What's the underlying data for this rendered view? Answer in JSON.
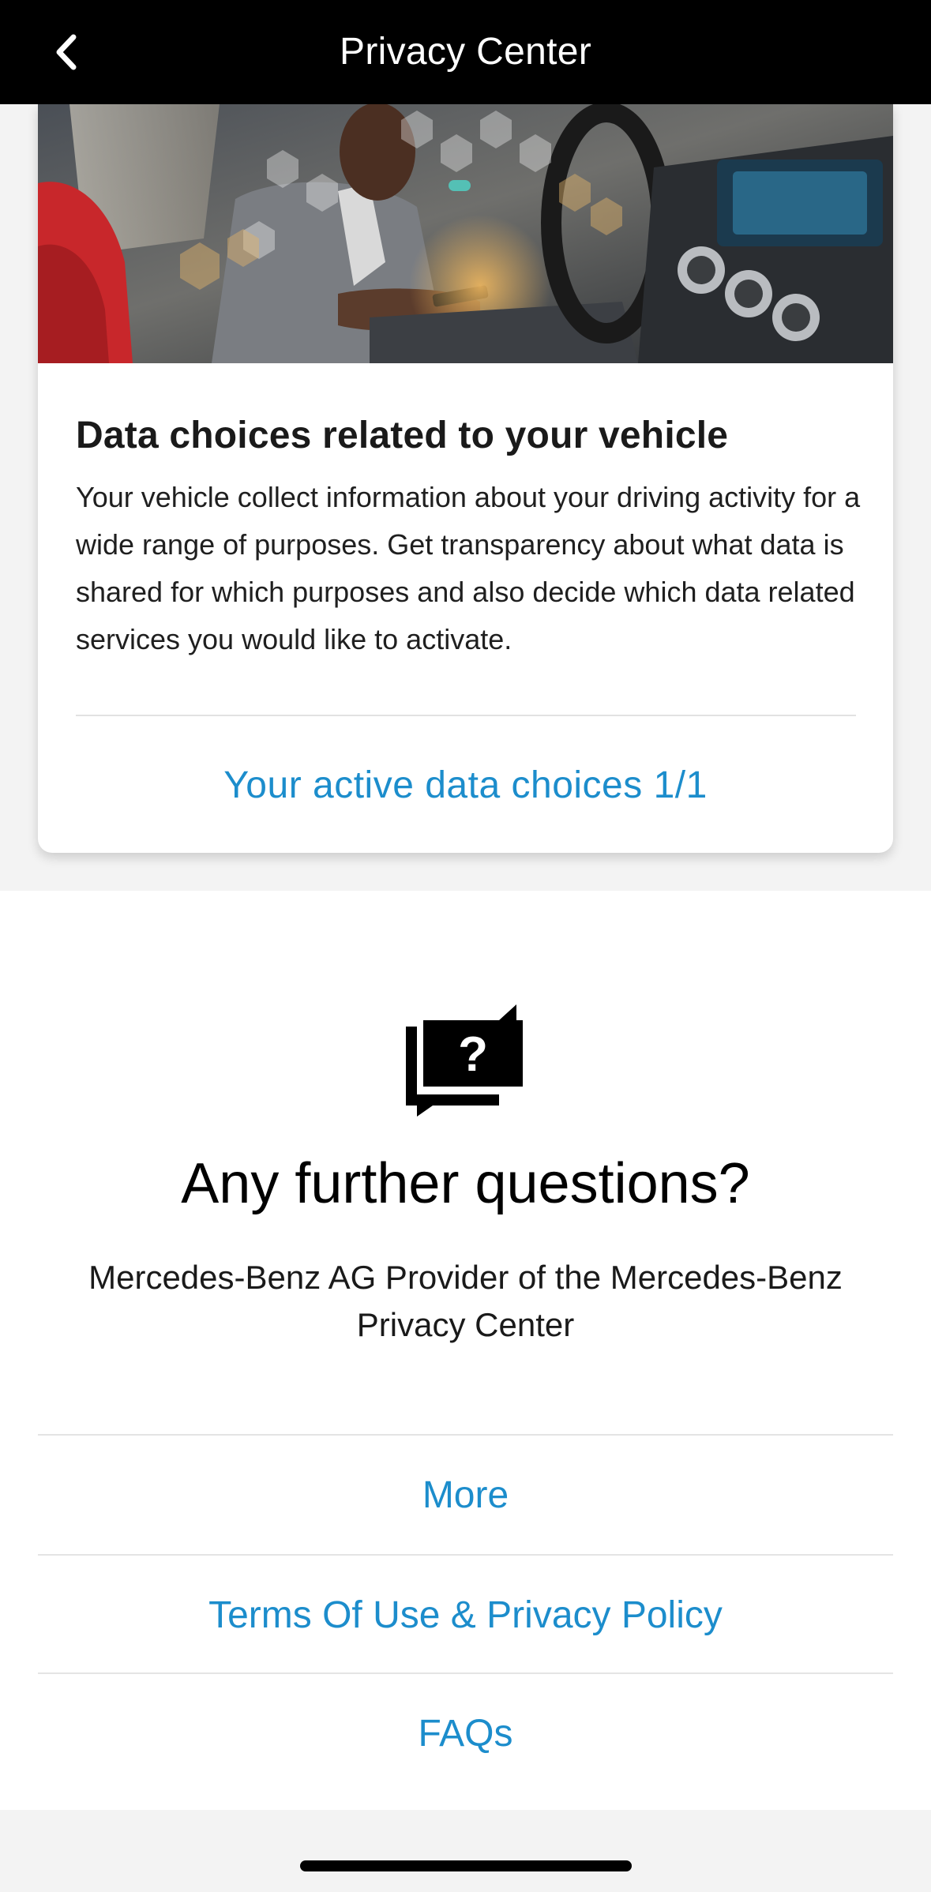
{
  "nav": {
    "title": "Privacy Center",
    "back_icon": "chevron-left-icon"
  },
  "card": {
    "image_description": "hero-image",
    "title": "Data choices related to your vehicle",
    "body": "Your vehicle collect information about your driving activity for a wide range of purposes. Get transparency about what data is shared for which purposes and also decide which data related services you would like to activate.",
    "active_choices_link": "Your active data choices 1/1"
  },
  "questions": {
    "icon": "question-chat-icon",
    "heading": "Any further questions?",
    "provider_text": "Mercedes-Benz AG Provider of the Mercedes-Benz Privacy Center",
    "links": [
      {
        "label": "More"
      },
      {
        "label": "Terms Of Use & Privacy Policy"
      },
      {
        "label": "FAQs"
      }
    ]
  },
  "colors": {
    "link": "#1c8dcc",
    "nav_background": "#000000",
    "page_background": "#f3f3f3"
  }
}
